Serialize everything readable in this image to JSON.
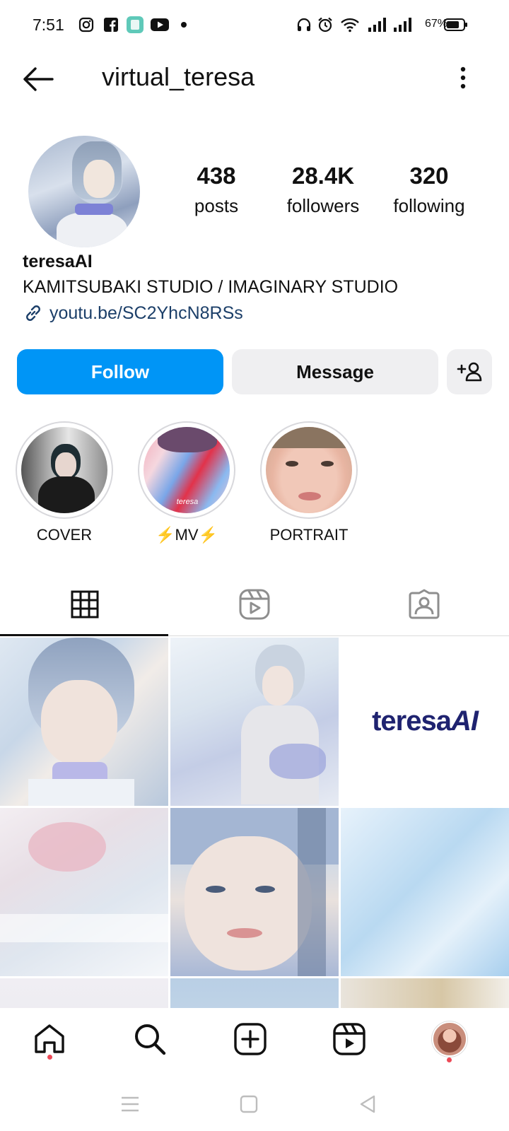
{
  "status_bar": {
    "time": "7:51",
    "battery_text": "67%",
    "left_icons": [
      "instagram-icon",
      "facebook-icon",
      "app-icon",
      "youtube-icon"
    ],
    "right_icons": [
      "headphones-icon",
      "alarm-icon",
      "wifi-icon",
      "signal-icon",
      "signal-icon",
      "battery-icon"
    ]
  },
  "header": {
    "username": "virtual_teresa"
  },
  "profile": {
    "stats": [
      {
        "value": "438",
        "label": "posts"
      },
      {
        "value": "28.4K",
        "label": "followers"
      },
      {
        "value": "320",
        "label": "following"
      }
    ],
    "display_name": "teresaAI",
    "bio": "KAMITSUBAKI STUDIO / IMAGINARY STUDIO",
    "link": "youtu.be/SC2YhcN8RSs"
  },
  "actions": {
    "follow_label": "Follow",
    "message_label": "Message"
  },
  "highlights": [
    {
      "label": "COVER"
    },
    {
      "label": "⚡MV⚡"
    },
    {
      "label": "PORTRAIT"
    }
  ],
  "grid": {
    "text_tile": "teresaAI",
    "text_tile_plain": "teresa",
    "text_tile_italic": "AI",
    "mv_tile_caption": "teresa"
  },
  "colors": {
    "accent": "#0095f6",
    "link": "#1c3f69",
    "notification_dot": "#ed4956"
  }
}
